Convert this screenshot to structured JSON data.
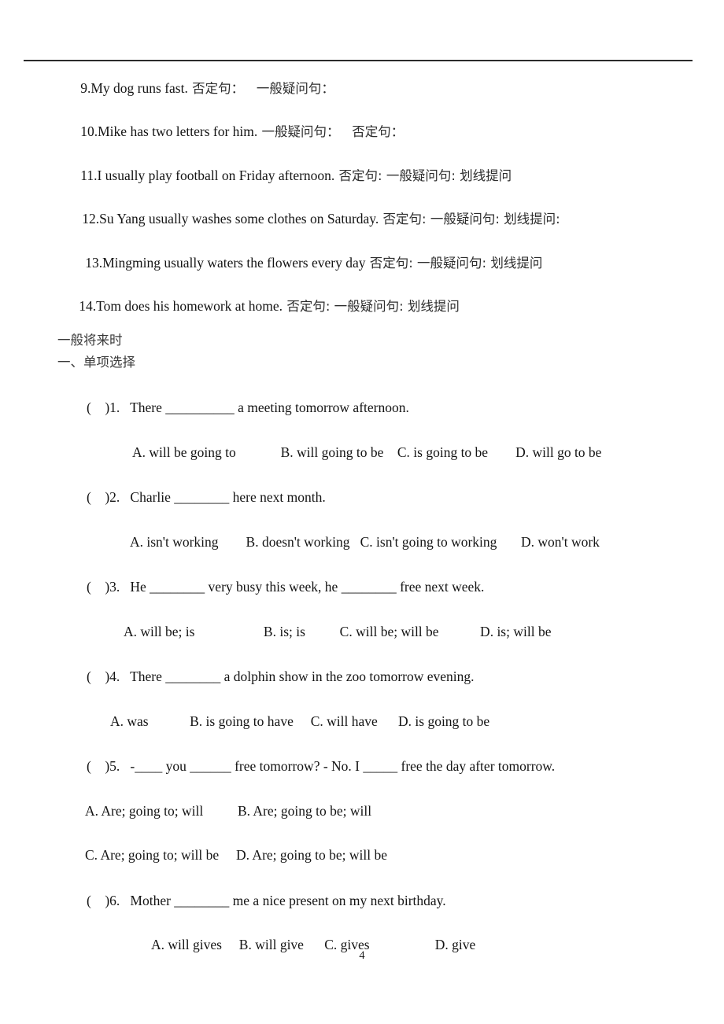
{
  "document": {
    "page_number": "4",
    "header_rule": true
  },
  "transform_exercises": {
    "items": [
      {
        "number": "9.",
        "sentence": "My dog runs fast.",
        "prompts": "否定句：   一般疑问句："
      },
      {
        "number": "10.",
        "sentence": "Mike has two letters for him.",
        "prompts": "一般疑问句：   否定句："
      },
      {
        "number": "11.",
        "sentence": "I usually play football on Friday afternoon.",
        "prompts": "否定句: 一般疑问句: 划线提问"
      },
      {
        "number": "12.",
        "sentence": "Su Yang usually washes some clothes on Saturday.",
        "prompts": "否定句: 一般疑问句: 划线提问:"
      },
      {
        "number": "13.",
        "sentence": "Mingming usually waters the flowers every day",
        "prompts": "否定句: 一般疑问句: 划线提问"
      },
      {
        "number": "14.",
        "sentence": "Tom does his homework at home.",
        "prompts": "否定句: 一般疑问句: 划线提问"
      }
    ]
  },
  "sections": {
    "tense_title": "一般将来时",
    "part_title": "一、单项选择"
  },
  "multiple_choice": {
    "questions": [
      {
        "bracket": "(    )",
        "number": "1.",
        "stem": "   There __________ a meeting tomorrow afternoon.",
        "option_rows": [
          "A. will be going to             B. will going to be    C. is going to be        D. will go to be"
        ]
      },
      {
        "bracket": "(    )",
        "number": "2.",
        "stem": "   Charlie ________ here next month.",
        "option_rows": [
          "A. isn't working        B. doesn't working   C. isn't going to working       D. won't work"
        ]
      },
      {
        "bracket": "(    )",
        "number": "3.",
        "stem": "   He ________ very busy this week, he ________ free next week.",
        "option_rows": [
          "A. will be; is                    B. is; is          C. will be; will be            D. is; will be"
        ]
      },
      {
        "bracket": "(    )",
        "number": "4.",
        "stem": "   There ________ a dolphin show in the zoo tomorrow evening.",
        "option_rows": [
          "A. was            B. is going to have     C. will have      D. is going to be"
        ]
      },
      {
        "bracket": "(    )",
        "number": "5.",
        "stem": "   -____ you ______ free tomorrow? - No. I _____ free the day after tomorrow.",
        "option_rows": [
          "A. Are; going to; will          B. Are; going to be; will",
          "C. Are; going to; will be     D. Are; going to be; will be"
        ]
      },
      {
        "bracket": "(    )",
        "number": "6.",
        "stem": "   Mother ________ me a nice present on my next birthday.",
        "option_rows": [
          "A. will gives     B. will give      C. gives                   D. give"
        ]
      }
    ]
  }
}
